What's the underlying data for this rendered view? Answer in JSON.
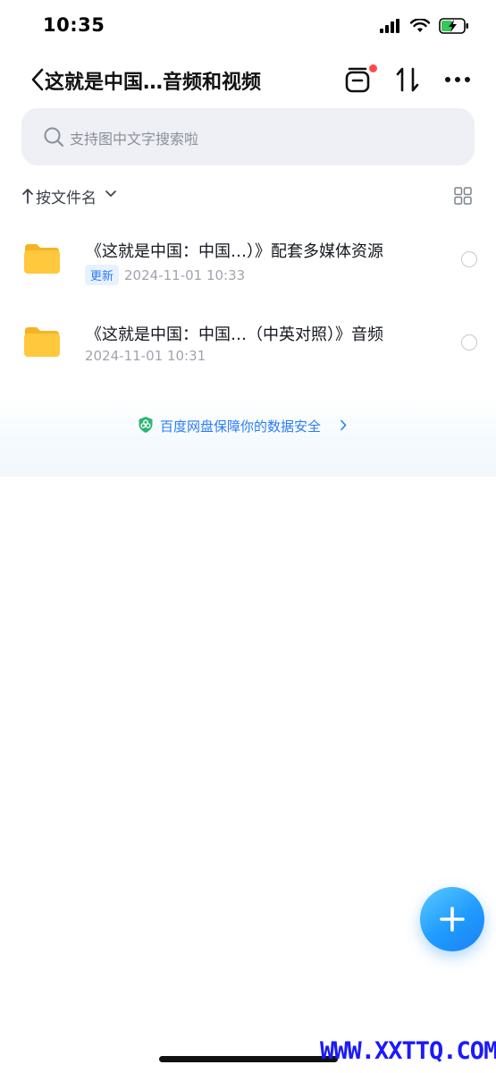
{
  "status_bar": {
    "time": "10:35",
    "icons": [
      "cellular-signal-icon",
      "wifi-icon",
      "battery-charging-icon"
    ]
  },
  "header": {
    "back_icon": "chevron-left-icon",
    "title": "这就是中国…音频和视频",
    "actions": [
      "transfer-list-icon",
      "sort-arrows-icon",
      "more-icon"
    ],
    "notification_color": "#ff4b4b"
  },
  "search": {
    "placeholder": "支持图中文字搜索啦"
  },
  "sort": {
    "label": "按文件名",
    "view_icon": "grid-view-icon"
  },
  "files": [
    {
      "name": "《这就是中国：中国…）》配套多媒体资源",
      "badge": "更新",
      "date": "2024-11-01 10:33",
      "icon": "folder-icon"
    },
    {
      "name": "《这就是中国：中国…（中英对照）》音频",
      "badge": "",
      "date": "2024-11-01 10:31",
      "icon": "folder-icon"
    }
  ],
  "safety": {
    "text": "百度网盘保障你的数据安全",
    "icon": "shield-icon"
  },
  "fab": {
    "icon": "plus-icon"
  },
  "watermark": "WWW.XXTTQ.COM",
  "colors": {
    "accent": "#2a7cf6",
    "folder": "#ffc83d",
    "search_bg": "#eef0f5"
  }
}
